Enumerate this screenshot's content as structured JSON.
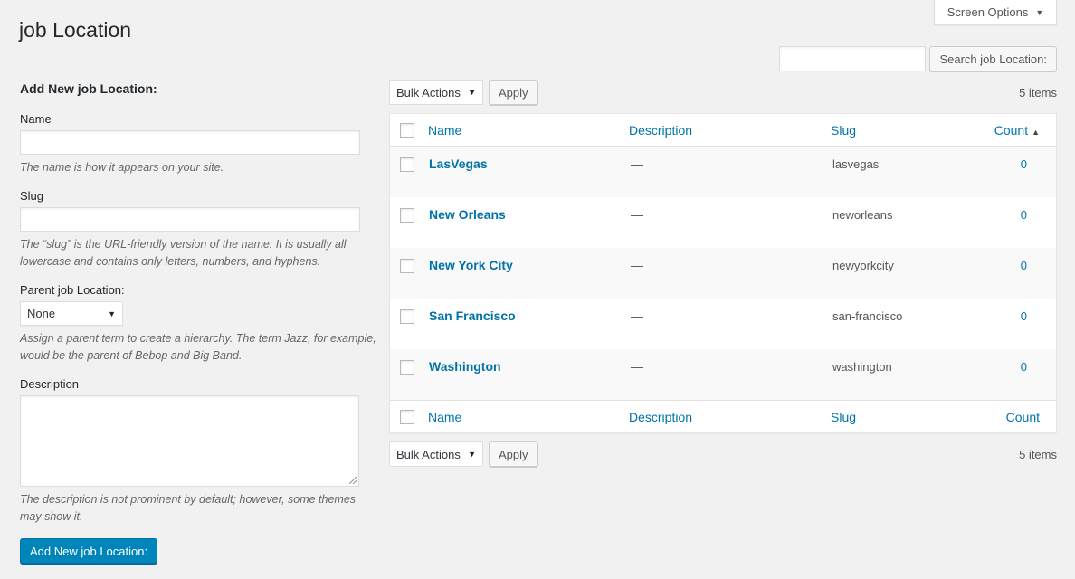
{
  "screen_options": {
    "label": "Screen Options",
    "icon": "caret-down-icon"
  },
  "page": {
    "title": "job Location"
  },
  "search": {
    "value": "",
    "button_label": "Search job Location:"
  },
  "form": {
    "title": "Add New job Location:",
    "name_label": "Name",
    "name_value": "",
    "name_hint": "The name is how it appears on your site.",
    "slug_label": "Slug",
    "slug_value": "",
    "slug_hint": "The “slug” is the URL-friendly version of the name. It is usually all lowercase and contains only letters, numbers, and hyphens.",
    "parent_label": "Parent job Location:",
    "parent_selected": "None",
    "parent_hint": "Assign a parent term to create a hierarchy. The term Jazz, for example, would be the parent of Bebop and Big Band.",
    "description_label": "Description",
    "description_value": "",
    "description_hint": "The description is not prominent by default; however, some themes may show it.",
    "submit_label": "Add New job Location:"
  },
  "tablenav": {
    "bulk_actions": "Bulk Actions",
    "apply_label": "Apply",
    "items_count": "5 items"
  },
  "table": {
    "columns": {
      "name": "Name",
      "description": "Description",
      "slug": "Slug",
      "count": "Count"
    },
    "sorted_column": "count",
    "sort_direction": "asc",
    "rows": [
      {
        "name": "LasVegas",
        "description": "—",
        "slug": "lasvegas",
        "count": "0"
      },
      {
        "name": "New Orleans",
        "description": "—",
        "slug": "neworleans",
        "count": "0"
      },
      {
        "name": "New York City",
        "description": "—",
        "slug": "newyorkcity",
        "count": "0"
      },
      {
        "name": "San Francisco",
        "description": "—",
        "slug": "san-francisco",
        "count": "0"
      },
      {
        "name": "Washington",
        "description": "—",
        "slug": "washington",
        "count": "0"
      }
    ]
  },
  "colors": {
    "link": "#0073aa",
    "primary_button": "#0085ba",
    "background": "#f1f1f1"
  }
}
